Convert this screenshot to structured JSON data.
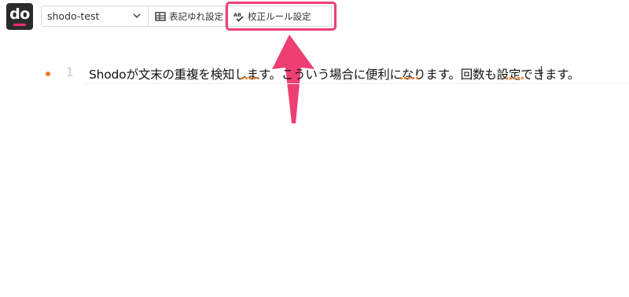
{
  "logo": {
    "text": "do"
  },
  "toolbar": {
    "project": {
      "name": "shodo-test",
      "icon": "chevron-down-icon"
    },
    "buttons": [
      {
        "label": "表記ゆれ設定",
        "icon": "table-icon"
      },
      {
        "label": "校正ルール設定",
        "icon": "spellcheck-icon"
      }
    ]
  },
  "editor": {
    "lines": [
      {
        "number": "1",
        "text": "Shodoが文末の重複を検知します。こういう場合に便利になります。回数も設定できます。"
      }
    ]
  },
  "colors": {
    "accent": "#ee3f73",
    "logo_bg": "#2b2b2b",
    "warning_dot": "#f07a24",
    "warning_underline": "#f08a3c"
  }
}
